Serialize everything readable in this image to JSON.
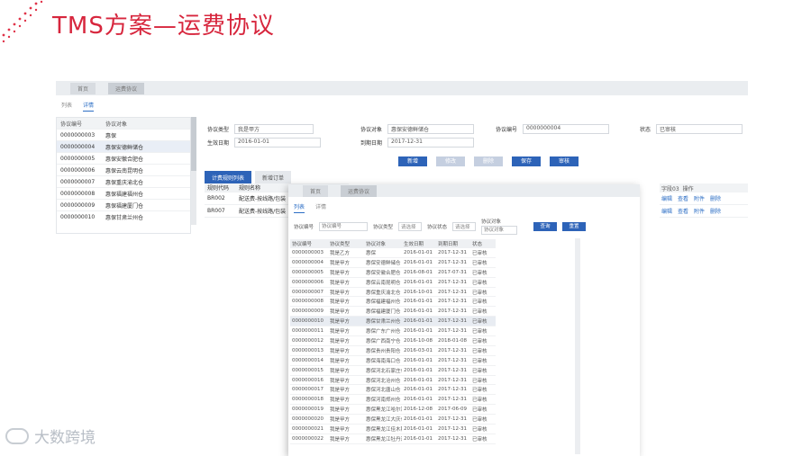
{
  "slide": {
    "title": "TMS方案—运费协议",
    "logo_text": "大数跨境",
    "accent_color": "#d7263d"
  },
  "back_window": {
    "tabs": [
      "首页",
      "运费协议"
    ],
    "subtabs": [
      "列表",
      "详情"
    ],
    "list_headers": [
      "协议编号",
      "协议对象"
    ],
    "list_rows": [
      [
        "0000000003",
        "惠保"
      ],
      [
        "0000000004",
        "惠保安德鲜储仓"
      ],
      [
        "0000000005",
        "惠保安徽合肥仓"
      ],
      [
        "0000000006",
        "惠保云南昆明仓"
      ],
      [
        "0000000007",
        "惠保重庆渝北仓"
      ],
      [
        "0000000008",
        "惠保福建福州仓"
      ],
      [
        "0000000009",
        "惠保福建厦门仓"
      ],
      [
        "0000000010",
        "惠保甘肃兰州仓"
      ]
    ],
    "form": {
      "type_label": "协议类型",
      "type_value": "我是甲方",
      "object_label": "协议对象",
      "object_value": "惠保安德鲜储仓",
      "number_label": "协议编号",
      "number_value": "0000000004",
      "status_label": "状态",
      "status_value": "已审核",
      "start_label": "生效日期",
      "start_value": "2016-01-01",
      "end_label": "到期日期",
      "end_value": "2017-12-31"
    },
    "buttons": [
      "新增",
      "修改",
      "删除",
      "保存",
      "审核"
    ],
    "rule_tabs": [
      "计费规则列表",
      "新增订单"
    ],
    "rule_headers": [
      "规则代码",
      "规则名称"
    ],
    "rule_rows": [
      [
        "BR002",
        "配送费-按线路/包装"
      ],
      [
        "BR007",
        "配送费-按线路/包装"
      ]
    ],
    "ops_header": [
      "字段03",
      "操作"
    ],
    "ops_actions": [
      "编辑",
      "查看",
      "附件",
      "删除"
    ]
  },
  "front_window": {
    "tabs": [
      "首页",
      "运费协议"
    ],
    "subtabs": [
      "列表",
      "详情"
    ],
    "filters": {
      "number_label": "协议编号",
      "number_placeholder": "协议编号",
      "type_label": "协议类型",
      "type_value": "请选择",
      "status_label": "协议状态",
      "status_value": "请选择",
      "object_label": "协议对象",
      "object_placeholder": "协议对象",
      "search_button": "查询",
      "reset_button": "重置"
    },
    "headers": [
      "协议编号",
      "协议类型",
      "协议对象",
      "生效日期",
      "到期日期",
      "状态"
    ],
    "rows": [
      [
        "0000000003",
        "我是乙方",
        "惠保",
        "2016-01-01",
        "2017-12-31",
        "已审核"
      ],
      [
        "0000000004",
        "我是甲方",
        "惠保安德鲜储仓",
        "2016-01-01",
        "2017-12-31",
        "已审核"
      ],
      [
        "0000000005",
        "我是甲方",
        "惠保安徽合肥仓",
        "2016-08-01",
        "2017-07-31",
        "已审核"
      ],
      [
        "0000000006",
        "我是甲方",
        "惠保云南昆明仓",
        "2016-01-01",
        "2017-12-31",
        "已审核"
      ],
      [
        "0000000007",
        "我是甲方",
        "惠保重庆渝北仓",
        "2016-10-01",
        "2017-12-31",
        "已审核"
      ],
      [
        "0000000008",
        "我是甲方",
        "惠保福建福州仓",
        "2016-01-01",
        "2017-12-31",
        "已审核"
      ],
      [
        "0000000009",
        "我是甲方",
        "惠保福建厦门仓",
        "2016-01-01",
        "2017-12-31",
        "已审核"
      ],
      [
        "0000000010",
        "我是甲方",
        "惠保甘肃兰州仓",
        "2016-01-01",
        "2017-12-31",
        "已审核"
      ],
      [
        "0000000011",
        "我是甲方",
        "惠保广东广州仓",
        "2016-01-01",
        "2017-12-31",
        "已审核"
      ],
      [
        "0000000012",
        "我是甲方",
        "惠保广西南宁仓",
        "2016-10-08",
        "2018-01-08",
        "已审核"
      ],
      [
        "0000000013",
        "我是甲方",
        "惠保贵州贵阳仓",
        "2016-03-01",
        "2017-12-31",
        "已审核"
      ],
      [
        "0000000014",
        "我是甲方",
        "惠保海南海口仓",
        "2016-01-01",
        "2017-12-31",
        "已审核"
      ],
      [
        "0000000015",
        "我是甲方",
        "惠保河北石家庄仓",
        "2016-01-01",
        "2017-12-31",
        "已审核"
      ],
      [
        "0000000016",
        "我是甲方",
        "惠保河北沧州仓",
        "2016-01-01",
        "2017-12-31",
        "已审核"
      ],
      [
        "0000000017",
        "我是甲方",
        "惠保河北唐山仓",
        "2016-01-01",
        "2017-12-31",
        "已审核"
      ],
      [
        "0000000018",
        "我是甲方",
        "惠保河南郑州仓",
        "2016-01-01",
        "2017-12-31",
        "已审核"
      ],
      [
        "0000000019",
        "我是甲方",
        "惠保黑龙江哈尔滨仓",
        "2016-12-08",
        "2017-06-09",
        "已审核"
      ],
      [
        "0000000020",
        "我是甲方",
        "惠保黑龙江大庆仓",
        "2016-01-01",
        "2017-12-31",
        "已审核"
      ],
      [
        "0000000021",
        "我是甲方",
        "惠保黑龙江佳木斯仓",
        "2016-01-01",
        "2017-12-31",
        "已审核"
      ],
      [
        "0000000022",
        "我是甲方",
        "惠保黑龙江牡丹江仓",
        "2016-01-01",
        "2017-12-31",
        "已审核"
      ]
    ]
  }
}
